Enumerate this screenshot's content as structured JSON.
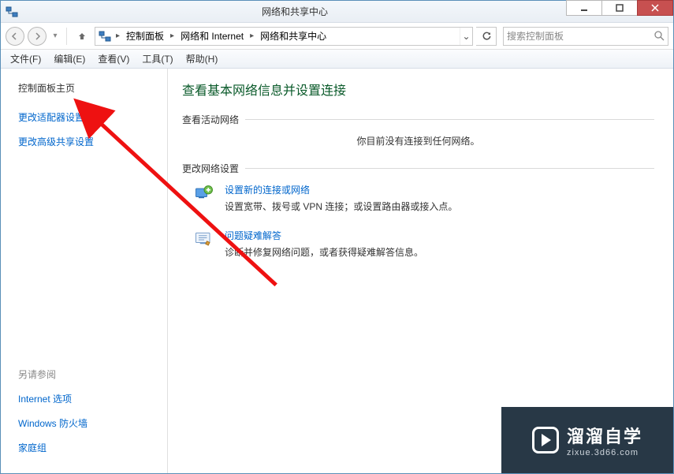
{
  "titlebar": {
    "title": "网络和共享中心"
  },
  "address": {
    "segments": [
      "控制面板",
      "网络和 Internet",
      "网络和共享中心"
    ]
  },
  "search": {
    "placeholder": "搜索控制面板"
  },
  "menu": {
    "file": "文件(F)",
    "edit": "编辑(E)",
    "view": "查看(V)",
    "tools": "工具(T)",
    "help": "帮助(H)"
  },
  "sidebar": {
    "home": "控制面板主页",
    "adapter": "更改适配器设置",
    "advanced": "更改高级共享设置",
    "seealso_head": "另请参阅",
    "seealso": [
      "Internet 选项",
      "Windows 防火墙",
      "家庭组"
    ]
  },
  "main": {
    "heading": "查看基本网络信息并设置连接",
    "active_networks_title": "查看活动网络",
    "no_connection": "你目前没有连接到任何网络。",
    "change_settings_title": "更改网络设置",
    "item1_title": "设置新的连接或网络",
    "item1_desc": "设置宽带、拨号或 VPN 连接；或设置路由器或接入点。",
    "item2_title": "问题疑难解答",
    "item2_desc": "诊断并修复网络问题，或者获得疑难解答信息。"
  },
  "watermark": {
    "line1": "溜溜自学",
    "line2": "zixue.3d66.com"
  }
}
